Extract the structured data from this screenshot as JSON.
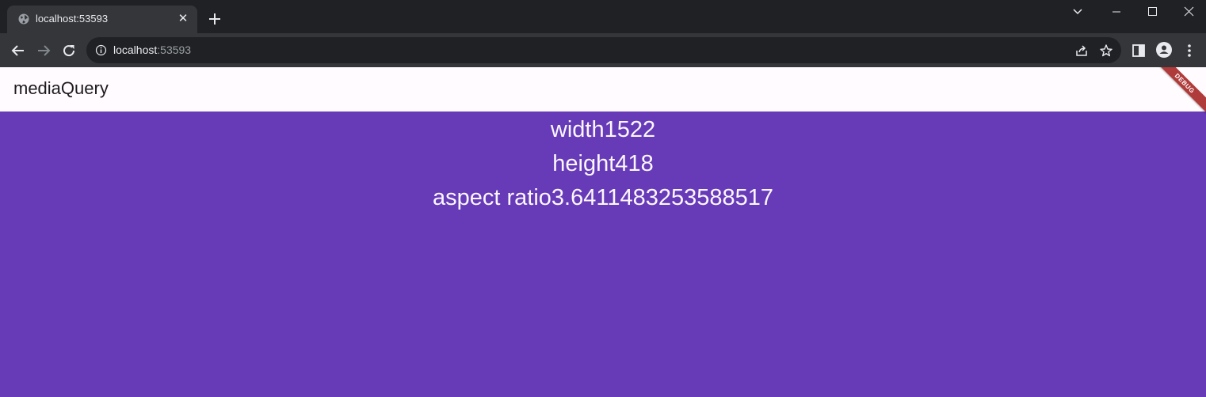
{
  "browser": {
    "tab": {
      "title": "localhost:53593",
      "close_glyph": "✕"
    },
    "url": {
      "host": "localhost",
      "port": ":53593"
    },
    "icons": [
      "globe-icon",
      "close-icon",
      "plus-icon",
      "chevron-down-icon",
      "minimize-icon",
      "maximize-icon",
      "window-close-icon",
      "back-arrow-icon",
      "forward-arrow-icon",
      "reload-icon",
      "info-icon",
      "share-icon",
      "star-icon",
      "side-panel-icon",
      "profile-icon",
      "more-vert-icon"
    ]
  },
  "app": {
    "title": "mediaQuery",
    "debug_label": "DEBUG",
    "colors": {
      "background": "#673ab7",
      "appbar": "#fffbfe",
      "text": "#fbf7ff",
      "debug": "#b03b3b"
    },
    "metrics": {
      "width": "width1522",
      "height": "height418",
      "aspect_ratio": "aspect ratio3.6411483253588517"
    }
  }
}
